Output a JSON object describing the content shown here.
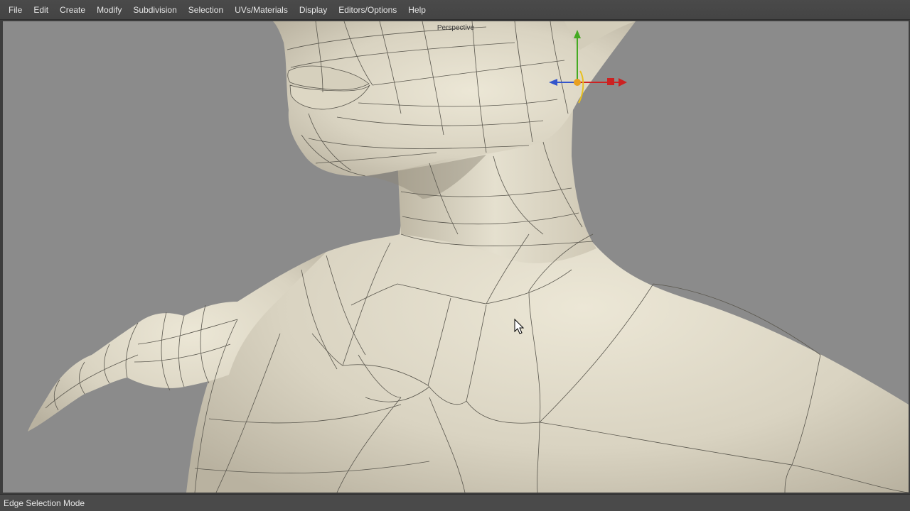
{
  "menubar": {
    "items": [
      {
        "label": "File",
        "name": "menu-file"
      },
      {
        "label": "Edit",
        "name": "menu-edit"
      },
      {
        "label": "Create",
        "name": "menu-create"
      },
      {
        "label": "Modify",
        "name": "menu-modify"
      },
      {
        "label": "Subdivision",
        "name": "menu-subdivision"
      },
      {
        "label": "Selection",
        "name": "menu-selection"
      },
      {
        "label": "UVs/Materials",
        "name": "menu-uvs-materials"
      },
      {
        "label": "Display",
        "name": "menu-display"
      },
      {
        "label": "Editors/Options",
        "name": "menu-editors-options"
      },
      {
        "label": "Help",
        "name": "menu-help"
      }
    ]
  },
  "viewport": {
    "label": "Perspective",
    "background": "#8b8b8b",
    "mesh_color": "#ddd8c8",
    "wire_color": "#5a574e"
  },
  "gizmo": {
    "x_axis_color": "#cc2222",
    "y_axis_color": "#44aa22",
    "z_axis_color": "#3355cc",
    "center_color": "#e8a020"
  },
  "cursor": {
    "icon": "mouse-pointer-icon"
  },
  "status": {
    "text": "Edge Selection Mode"
  }
}
